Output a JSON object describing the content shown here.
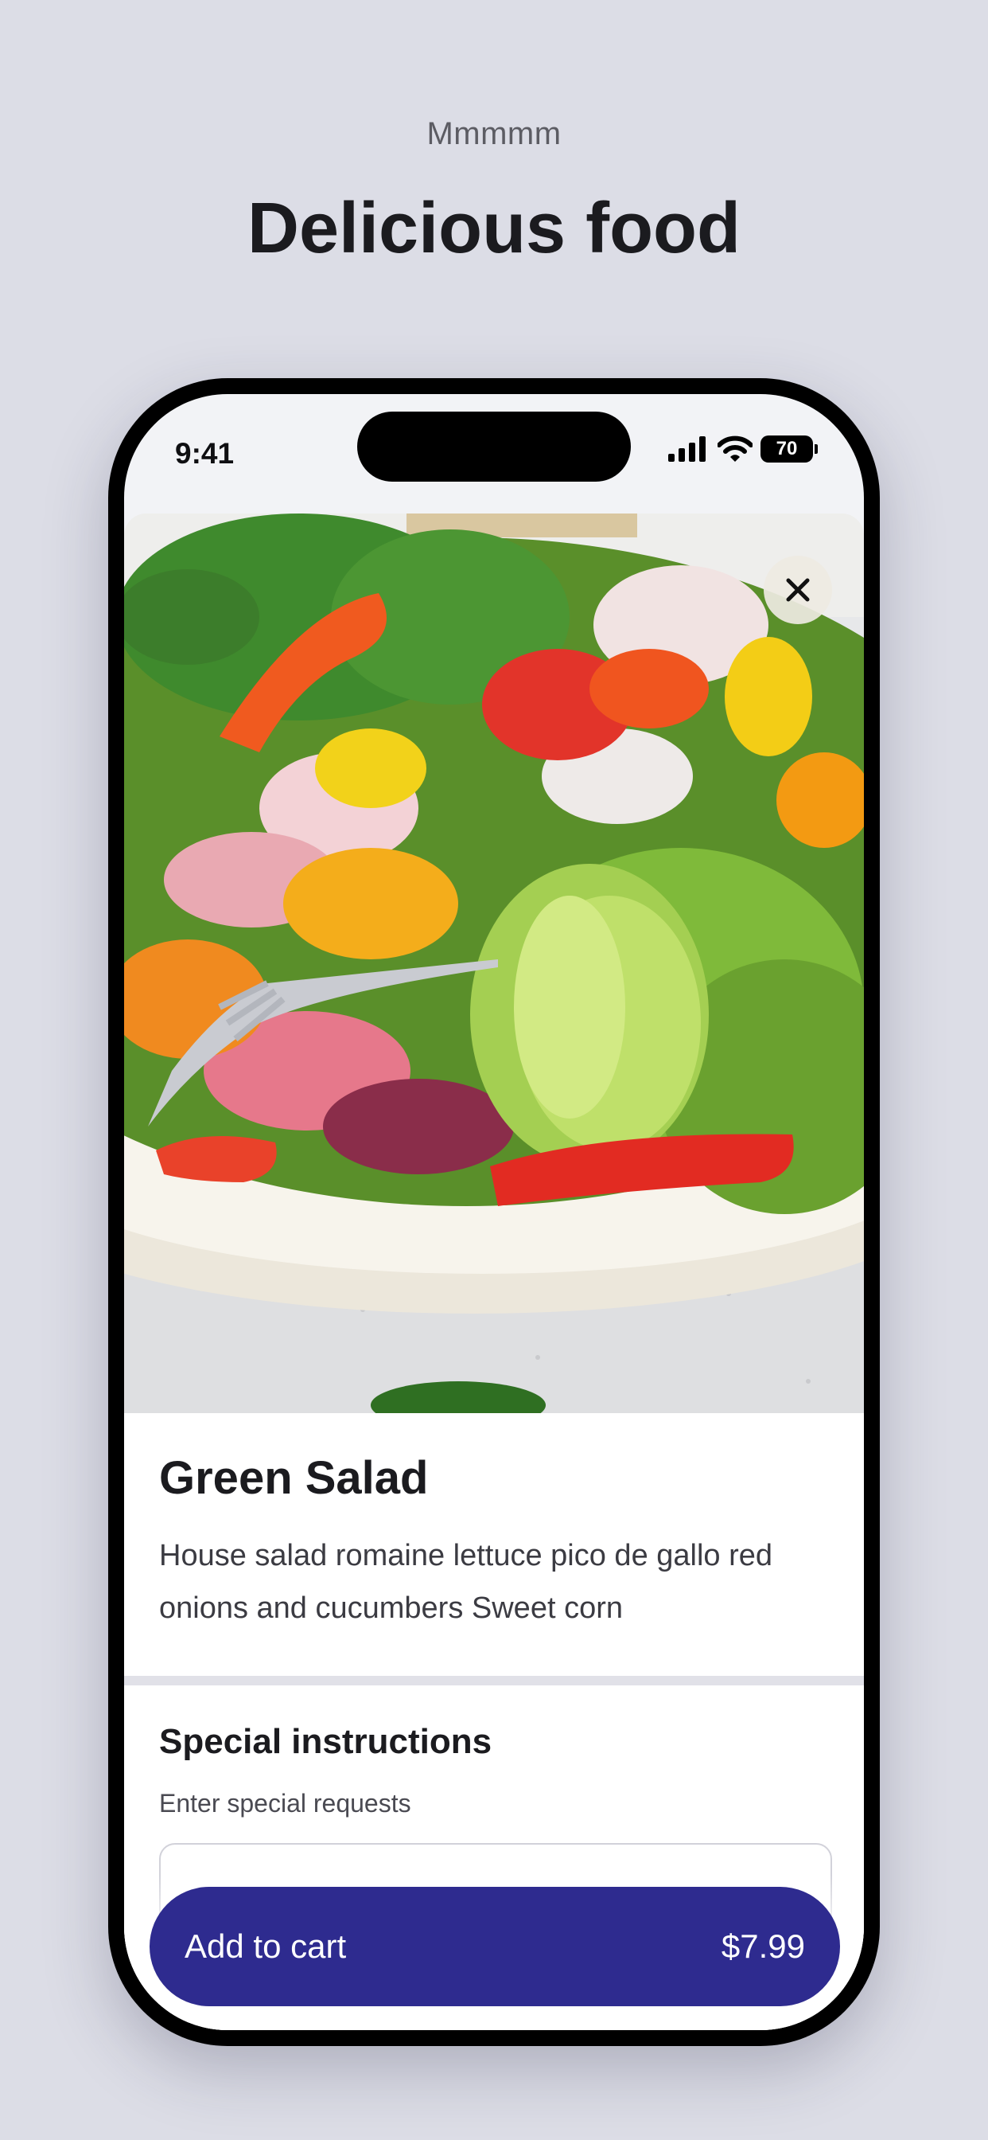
{
  "page": {
    "eyebrow": "Mmmmm",
    "headline": "Delicious food"
  },
  "status_bar": {
    "time": "9:41",
    "battery": "70",
    "icons": [
      "cellular-signal-icon",
      "wifi-icon",
      "battery-icon"
    ]
  },
  "product": {
    "image": "salad-photo",
    "name": "Green Salad",
    "description": "House salad romaine lettuce pico de gallo red onions and cucumbers Sweet corn"
  },
  "instructions": {
    "title": "Special instructions",
    "hint": "Enter special requests",
    "value": ""
  },
  "cart": {
    "label": "Add to cart",
    "price": "$7.99"
  },
  "colors": {
    "background": "#dcdde6",
    "accent": "#2e2b8f",
    "text": "#1b1b1f"
  }
}
